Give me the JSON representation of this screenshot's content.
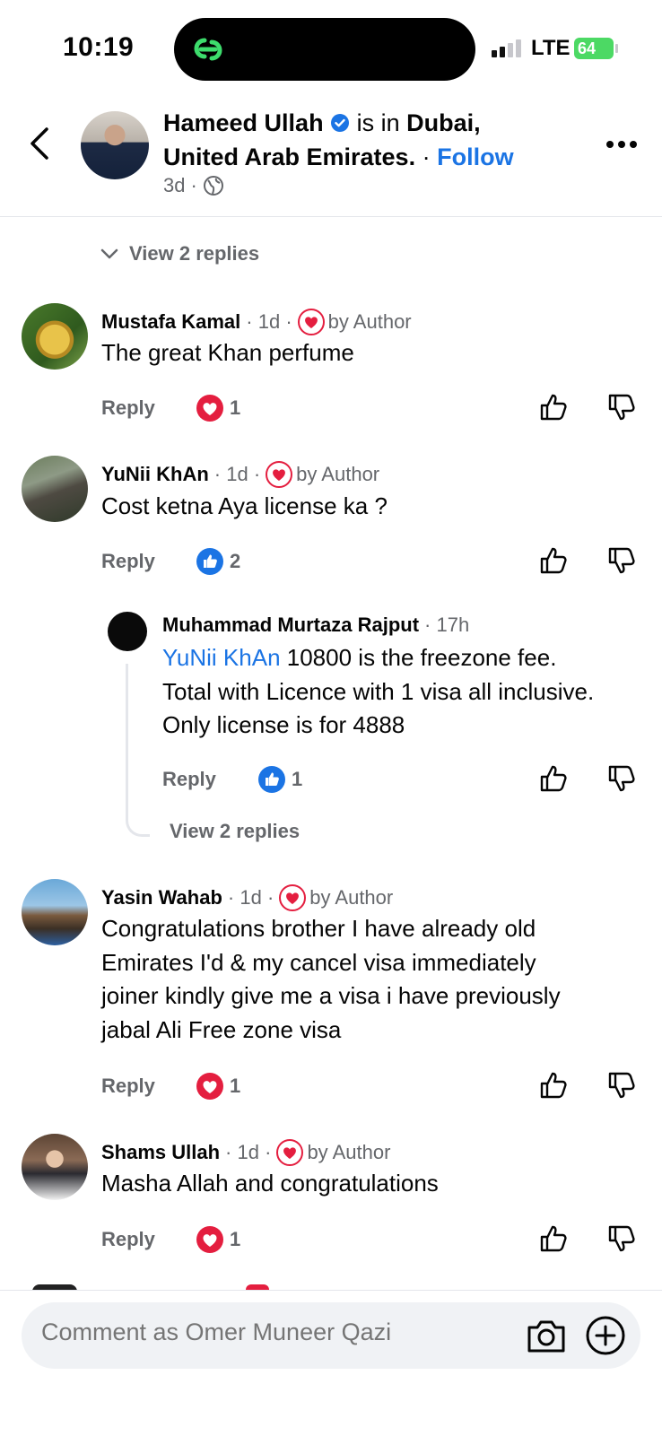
{
  "status_bar": {
    "time": "10:19",
    "network": "LTE",
    "battery": "64"
  },
  "header": {
    "name": "Hameed Ullah",
    "is_in": "is in",
    "place_line1": "Dubai,",
    "place_line2": "United Arab Emirates.",
    "follow": "Follow",
    "age": "3d",
    "separator": "·"
  },
  "top_view_replies": "View 2 replies",
  "comments": [
    {
      "name": "Mustafa Kamal",
      "age": "1d",
      "by_author": "by Author",
      "text": "The great Khan perfume",
      "reply": "Reply",
      "reaction": "heart",
      "count": "1"
    },
    {
      "name": "YuNii KhAn",
      "age": "1d",
      "by_author": "by Author",
      "text": "Cost ketna Aya license ka ?",
      "reply": "Reply",
      "reaction": "like",
      "count": "2"
    },
    {
      "name": "Yasin Wahab",
      "age": "1d",
      "by_author": "by Author",
      "text": [
        "Congratulations brother I have already old",
        "Emirates I'd & my cancel visa immediately",
        "joiner kindly give me a visa i have previously",
        "jabal Ali Free zone visa"
      ],
      "reply": "Reply",
      "reaction": "heart",
      "count": "1"
    },
    {
      "name": "Shams Ullah",
      "age": "1d",
      "by_author": "by Author",
      "text": "Masha Allah and congratulations",
      "reply": "Reply",
      "reaction": "heart",
      "count": "1"
    }
  ],
  "nested_reply": {
    "name": "Muhammad Murtaza Rajput",
    "age": "17h",
    "mention": "YuNii KhAn",
    "text_line1": "10800 is the freezone fee.",
    "text_line2": "Total with Licence with 1 visa all inclusive.",
    "text_line3": "Only license is for 4888",
    "reply": "Reply",
    "reaction": "like",
    "count": "1",
    "view_replies": "View 2 replies"
  },
  "composer": {
    "placeholder": "Comment as Omer Muneer Qazi"
  },
  "colors": {
    "link_blue": "#1b74e4",
    "heart_red": "#e41e3f",
    "battery_green": "#4cd964",
    "gray_text": "#65676b"
  }
}
